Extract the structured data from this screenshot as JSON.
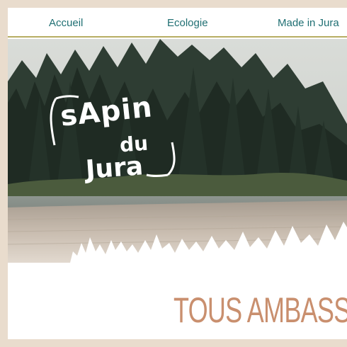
{
  "nav": {
    "items": [
      {
        "label": "Accueil"
      },
      {
        "label": "Ecologie"
      },
      {
        "label": "Made in Jura"
      }
    ]
  },
  "hero": {
    "logo": {
      "line1": "sApin",
      "line2": "du",
      "line3": "Jura"
    }
  },
  "section": {
    "headline": "TOUS AMBASSA"
  },
  "colors": {
    "nav_text": "#1f6f73",
    "nav_border": "#b7ad63",
    "headline": "#c98f6e",
    "frame": "#e9dccd"
  }
}
